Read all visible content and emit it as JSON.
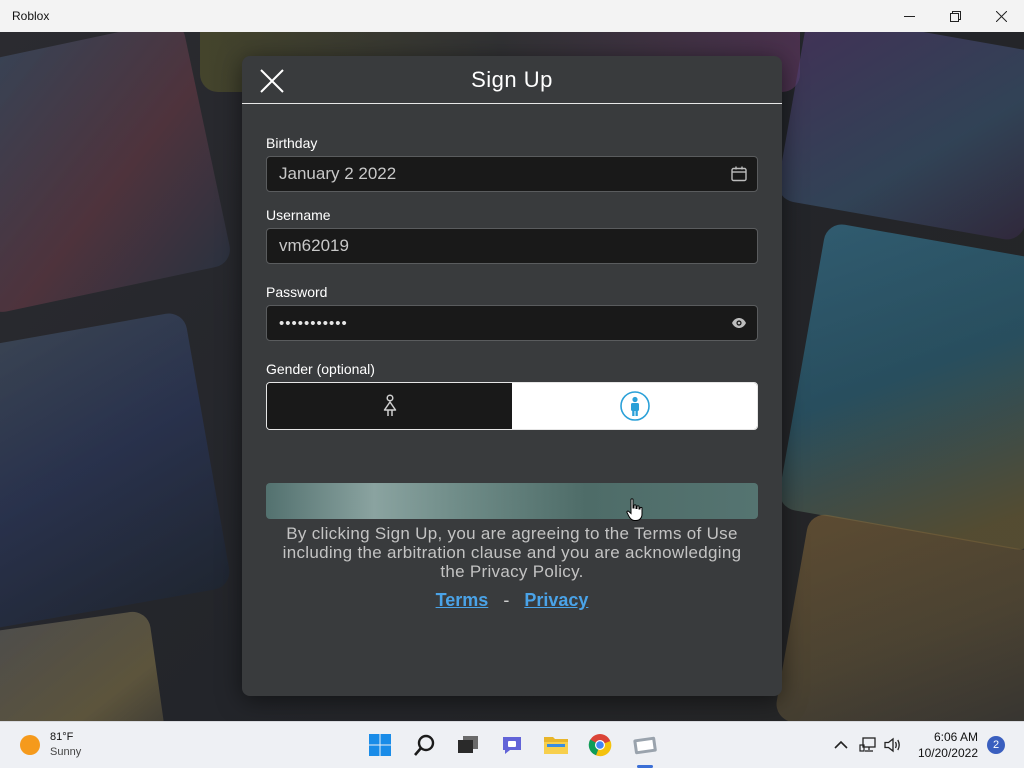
{
  "window": {
    "title": "Roblox",
    "controls": [
      "minimize-icon",
      "restore-icon",
      "close-icon"
    ]
  },
  "dialog": {
    "title": "Sign Up",
    "close_icon": "close-icon",
    "birthday": {
      "label": "Birthday",
      "value": "January 2 2022",
      "icon": "calendar-icon"
    },
    "username": {
      "label": "Username",
      "value": "vm62019"
    },
    "password": {
      "label": "Password",
      "value": "•••••••••••",
      "icon": "eye-icon"
    },
    "gender": {
      "label": "Gender (optional)",
      "options": [
        {
          "name": "female",
          "icon": "female-icon",
          "selected": false
        },
        {
          "name": "male",
          "icon": "male-icon",
          "selected": true
        }
      ]
    },
    "signup_button": {
      "label": ""
    },
    "terms_text": "By clicking Sign Up, you are agreeing to the Terms of Use including the arbitration clause and you are acknowledging the Privacy Policy.",
    "links": {
      "terms": "Terms",
      "separator": "-",
      "privacy": "Privacy"
    }
  },
  "taskbar": {
    "weather": {
      "temp": "81°F",
      "condition": "Sunny"
    },
    "apps": [
      "windows-start-icon",
      "search-icon",
      "task-view-icon",
      "teams-chat-icon",
      "file-explorer-icon",
      "chrome-icon",
      "roblox-icon"
    ],
    "active_app": "roblox-icon",
    "tray": [
      "chevron-up-icon",
      "network-icon",
      "volume-icon"
    ],
    "time": "6:06 AM",
    "date": "10/20/2022",
    "notification_count": "2"
  },
  "colors": {
    "dialog_bg": "#393b3d",
    "input_bg": "#191919",
    "link": "#4aa3e8",
    "selected_gender_icon": "#2aa0d8"
  }
}
